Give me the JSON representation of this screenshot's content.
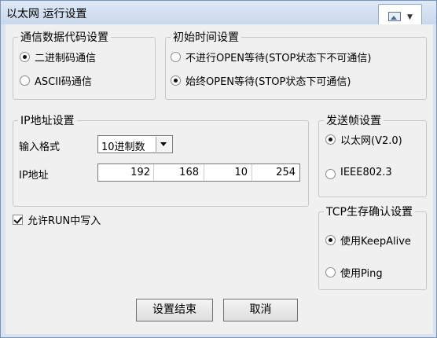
{
  "window": {
    "title": "以太网 运行设置"
  },
  "comm_code": {
    "legend": "通信数据代码设置",
    "options": [
      {
        "label": "二进制码通信",
        "selected": true
      },
      {
        "label": "ASCII码通信",
        "selected": false
      }
    ]
  },
  "initial_timing": {
    "legend": "初始时间设置",
    "options": [
      {
        "label": "不进行OPEN等待(STOP状态下不可通信)",
        "selected": false
      },
      {
        "label": "始终OPEN等待(STOP状态下可通信)",
        "selected": true
      }
    ]
  },
  "ip_settings": {
    "legend": "IP地址设置",
    "format_label": "输入格式",
    "format_value": "10进制数",
    "address_label": "IP地址",
    "octets": [
      "192",
      "168",
      "10",
      "254"
    ]
  },
  "send_frame": {
    "legend": "发送帧设置",
    "options": [
      {
        "label": "以太网(V2.0)",
        "selected": true
      },
      {
        "label": "IEEE802.3",
        "selected": false
      }
    ]
  },
  "tcp_keepalive": {
    "legend": "TCP生存确认设置",
    "options": [
      {
        "label": "使用KeepAlive",
        "selected": true
      },
      {
        "label": "使用Ping",
        "selected": false
      }
    ]
  },
  "allow_run_write": {
    "label": "允许RUN中写入",
    "checked": true
  },
  "buttons": {
    "ok": "设置结束",
    "cancel": "取消"
  }
}
